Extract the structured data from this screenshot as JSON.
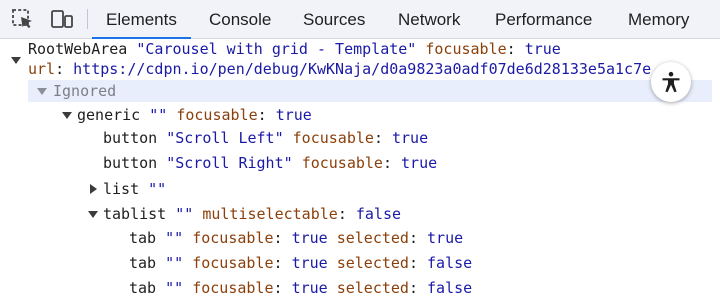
{
  "toolbar": {
    "tabs": [
      {
        "label": "Elements"
      },
      {
        "label": "Console"
      },
      {
        "label": "Sources"
      },
      {
        "label": "Network"
      },
      {
        "label": "Performance"
      },
      {
        "label": "Memory"
      }
    ],
    "active_tab": "Elements"
  },
  "tree": {
    "root": {
      "role": "RootWebArea",
      "name": "\"Carousel with grid - Template\"",
      "focusable_key": "focusable",
      "focusable_val": "true",
      "url_key": "url",
      "url_val": "https://cdpn.io/pen/debug/KwKNaja/d0a9823a0adf07de6d28133e5a1c7e"
    },
    "ignored": {
      "label": "Ignored"
    },
    "generic": {
      "role": "generic",
      "name": "\"\"",
      "focusable_key": "focusable",
      "focusable_val": "true"
    },
    "button_left": {
      "role": "button",
      "name": "\"Scroll Left\"",
      "focusable_key": "focusable",
      "focusable_val": "true"
    },
    "button_right": {
      "role": "button",
      "name": "\"Scroll Right\"",
      "focusable_key": "focusable",
      "focusable_val": "true"
    },
    "list": {
      "role": "list",
      "name": "\"\""
    },
    "tablist": {
      "role": "tablist",
      "name": "\"\"",
      "ms_key": "multiselectable",
      "ms_val": "false"
    },
    "tabs": [
      {
        "role": "tab",
        "name": "\"\"",
        "focusable_key": "focusable",
        "focusable_val": "true",
        "selected_key": "selected",
        "selected_val": "true"
      },
      {
        "role": "tab",
        "name": "\"\"",
        "focusable_key": "focusable",
        "focusable_val": "true",
        "selected_key": "selected",
        "selected_val": "false"
      },
      {
        "role": "tab",
        "name": "\"\"",
        "focusable_key": "focusable",
        "focusable_val": "true",
        "selected_key": "selected",
        "selected_val": "false"
      }
    ]
  },
  "icons": {
    "inspect": "inspect-element-icon",
    "device": "device-toolbar-icon",
    "accessibility": "accessibility-icon"
  },
  "colors": {
    "accent": "#1a73e8",
    "string": "#1a1aa6",
    "property": "#8b3f0a",
    "ignored_bg": "#e8eefb"
  }
}
